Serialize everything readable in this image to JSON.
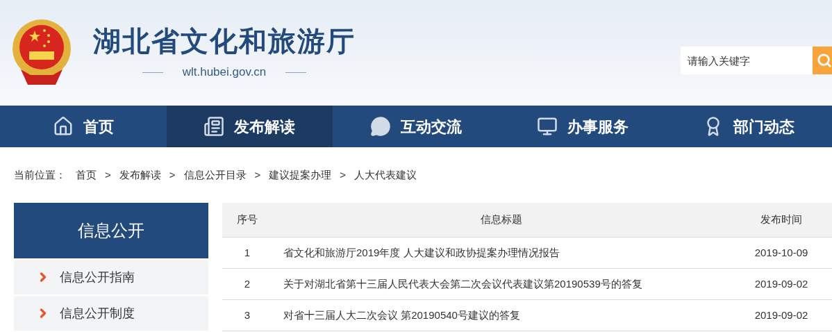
{
  "header": {
    "title": "湖北省文化和旅游厅",
    "domain": "wlt.hubei.gov.cn",
    "search": {
      "placeholder": "请输入关键字"
    }
  },
  "nav": [
    {
      "label": "首页",
      "selected": false
    },
    {
      "label": "发布解读",
      "selected": true
    },
    {
      "label": "互动交流",
      "selected": false
    },
    {
      "label": "办事服务",
      "selected": false
    },
    {
      "label": "部门动态",
      "selected": false
    }
  ],
  "breadcrumb": {
    "label": "当前位置：",
    "separator": ">",
    "items": [
      "首页",
      "发布解读",
      "信息公开目录",
      "建议提案办理",
      "人大代表建议"
    ]
  },
  "sidebar": {
    "title": "信息公开",
    "items": [
      "信息公开指南",
      "信息公开制度"
    ]
  },
  "table": {
    "columns": [
      "序号",
      "信息标题",
      "发布时间"
    ],
    "rows": [
      [
        "1",
        "省文化和旅游厅2019年度 人大建议和政协提案办理情况报告",
        "2019-10-09"
      ],
      [
        "2",
        "关于对湖北省第十三届人民代表大会第二次会议代表建议第20190539号的答复",
        "2019-09-02"
      ],
      [
        "3",
        "对省十三届人大二次会议 第20190540号建议的答复",
        "2019-09-02"
      ]
    ]
  }
}
